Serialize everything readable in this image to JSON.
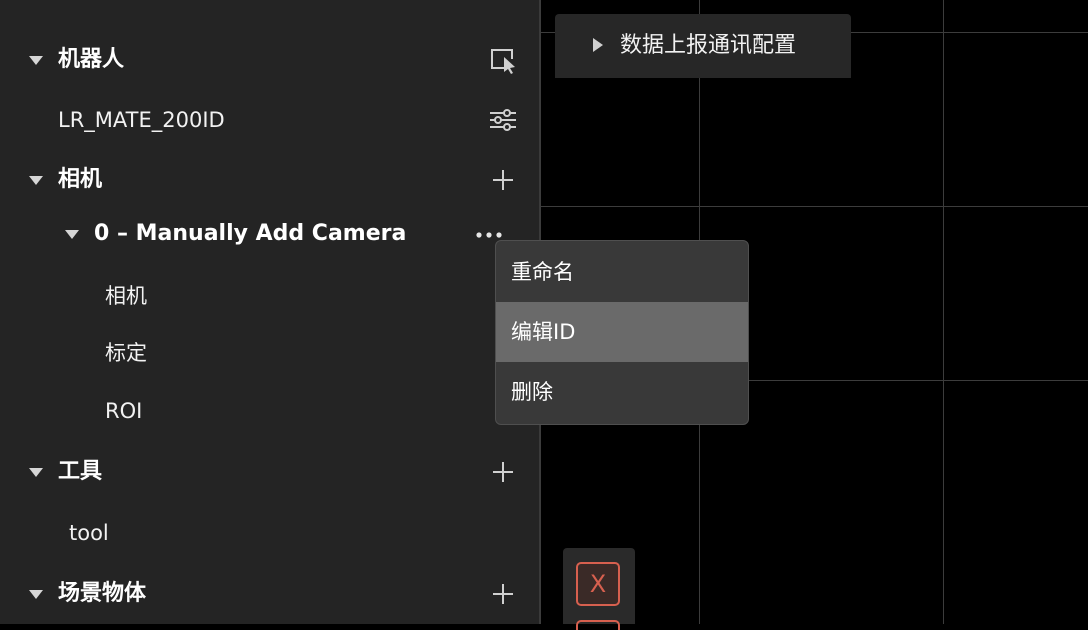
{
  "tree": {
    "robot_section": {
      "label": "机器人"
    },
    "robot_item": {
      "label": "LR_MATE_200ID"
    },
    "camera_section": {
      "label": "相机"
    },
    "camera_group": {
      "label": "0 – Manually Add Camera"
    },
    "camera_children": [
      {
        "label": "相机"
      },
      {
        "label": "标定"
      },
      {
        "label": "ROI"
      }
    ],
    "tool_section": {
      "label": "工具"
    },
    "tool_item": {
      "label": "tool"
    },
    "scene_section": {
      "label": "场景物体"
    }
  },
  "comm_panel": {
    "label": "数据上报通讯配置"
  },
  "context_menu": {
    "items": [
      {
        "label": "重命名"
      },
      {
        "label": "编辑ID"
      },
      {
        "label": "删除"
      }
    ],
    "selected_index": 1
  },
  "toolbar": {
    "close_glyph": "X"
  },
  "icons": {
    "select_cursor": "cursor-select-icon",
    "settings": "sliders-icon",
    "add": "plus-icon",
    "more": "ellipsis-icon",
    "expand": "caret-down-icon"
  },
  "colors": {
    "panel_bg": "#242424",
    "menu_bg": "#393939",
    "menu_selected": "#6a6a6a",
    "danger": "#d7604f"
  }
}
